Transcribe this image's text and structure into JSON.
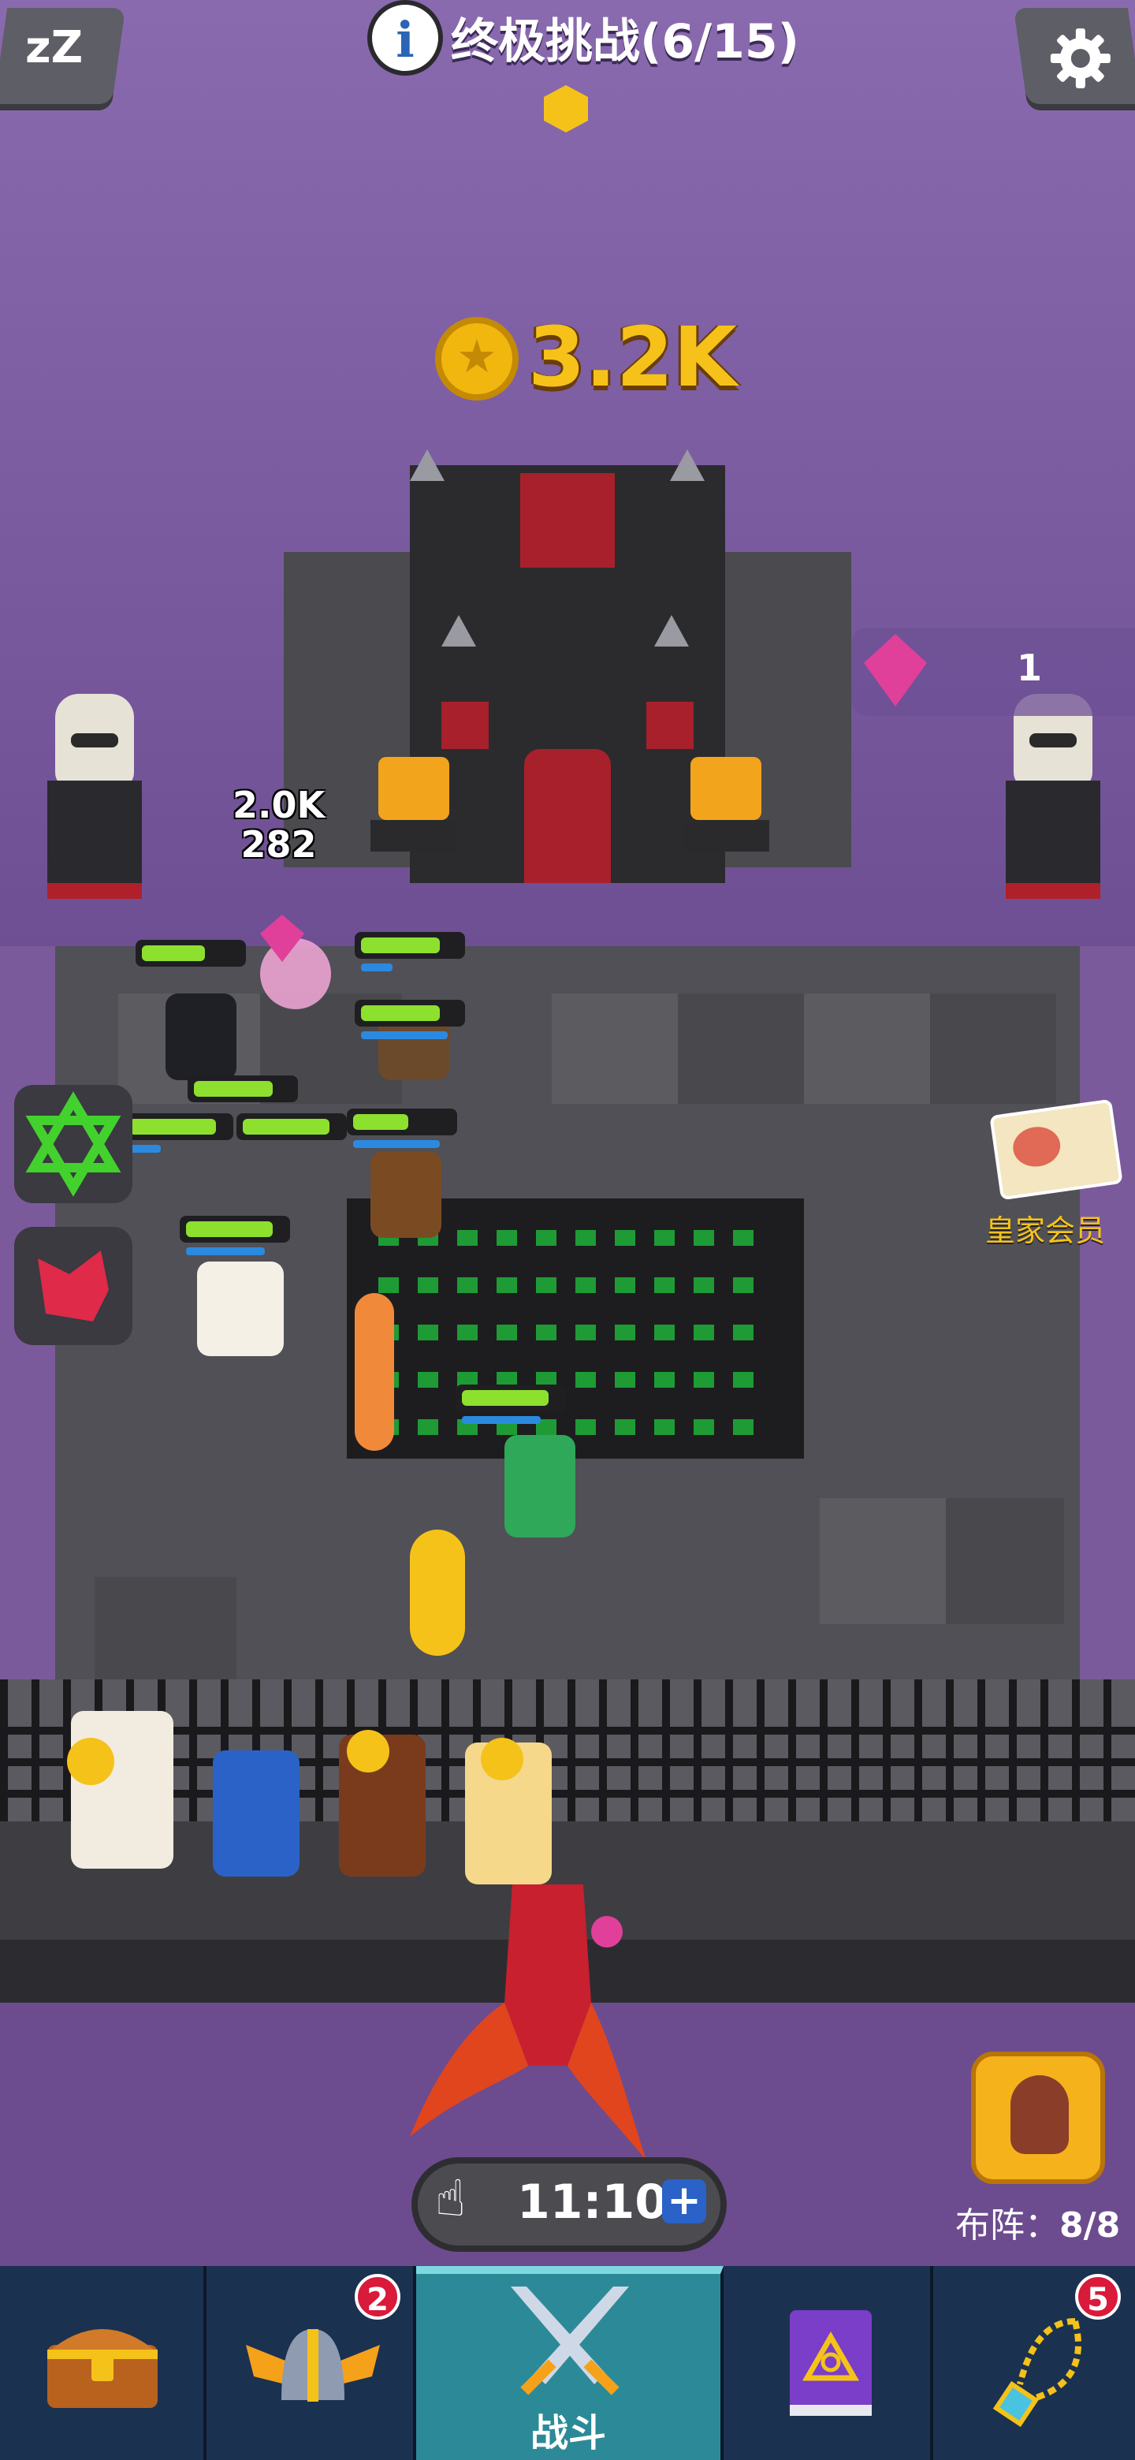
{
  "hud": {
    "sleep_label": "z\nz z",
    "info_symbol": "i",
    "challenge_title": "终极挑战(6/15)",
    "coins": "3.2K",
    "gems": "1",
    "damage_top": "2.0K",
    "damage_bottom": "282",
    "royal_member_label": "皇家会员"
  },
  "timer": {
    "value": "11:10",
    "plus": "+"
  },
  "formation": {
    "label": "布阵：",
    "count": "8/8"
  },
  "nav": {
    "items": [
      {
        "id": "chest",
        "label": "",
        "badge": ""
      },
      {
        "id": "heroes",
        "label": "",
        "badge": "2"
      },
      {
        "id": "battle",
        "label": "战斗",
        "badge": ""
      },
      {
        "id": "spellbook",
        "label": "",
        "badge": ""
      },
      {
        "id": "amulet",
        "label": "",
        "badge": "5"
      }
    ]
  },
  "colors": {
    "gold": "#f6c21a",
    "health": "#8de02e",
    "mana": "#2b8ae0",
    "badge_red": "#d91a3a",
    "active_tab": "#2c8a98"
  }
}
